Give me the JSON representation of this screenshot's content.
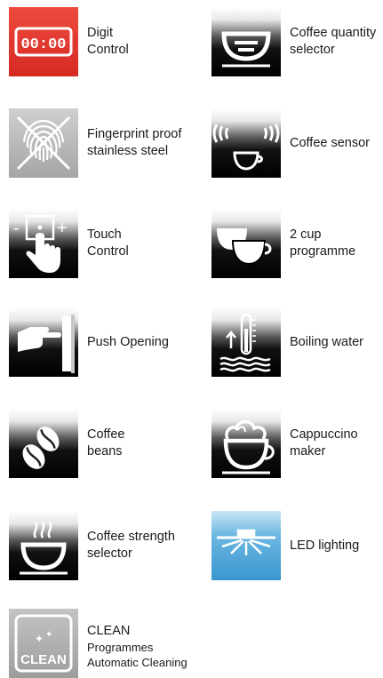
{
  "colors": {
    "digit_red": "#e8382f",
    "fingerprint_grey": "#b9b9b9",
    "led_blue": "#3e9fd5",
    "clean_grey": "#a9a9a9",
    "icon_black": "#000000"
  },
  "features": [
    {
      "icon": "digit-display-icon",
      "lines": [
        "Digit",
        "Control"
      ],
      "display_text": "00:00"
    },
    {
      "icon": "fingerprint-crossed-icon",
      "lines": [
        "Fingerprint proof",
        "stainless steel"
      ]
    },
    {
      "icon": "touch-control-icon",
      "lines": [
        "Touch",
        "Control"
      ],
      "minus": "-",
      "plus": "+"
    },
    {
      "icon": "push-opening-icon",
      "lines": [
        "Push Opening"
      ]
    },
    {
      "icon": "coffee-beans-icon",
      "lines": [
        "Coffee",
        "beans"
      ]
    },
    {
      "icon": "steaming-cup-icon",
      "lines": [
        "Coffee strength",
        "selector"
      ]
    },
    {
      "icon": "clean-icon",
      "lines": [
        "CLEAN",
        "Programmes",
        "Automatic Cleaning"
      ],
      "badge_text": "CLEAN"
    },
    {
      "icon": "cup-quantity-icon",
      "lines": [
        "Coffee quantity",
        "selector"
      ]
    },
    {
      "icon": "coffee-sensor-icon",
      "lines": [
        "Coffee sensor"
      ]
    },
    {
      "icon": "two-cups-icon",
      "lines": [
        "2 cup",
        "programme"
      ]
    },
    {
      "icon": "boiling-water-icon",
      "lines": [
        "Boiling water"
      ]
    },
    {
      "icon": "cappuccino-cup-icon",
      "lines": [
        "Cappuccino",
        "maker"
      ]
    },
    {
      "icon": "led-light-icon",
      "lines": [
        "LED lighting"
      ]
    }
  ]
}
